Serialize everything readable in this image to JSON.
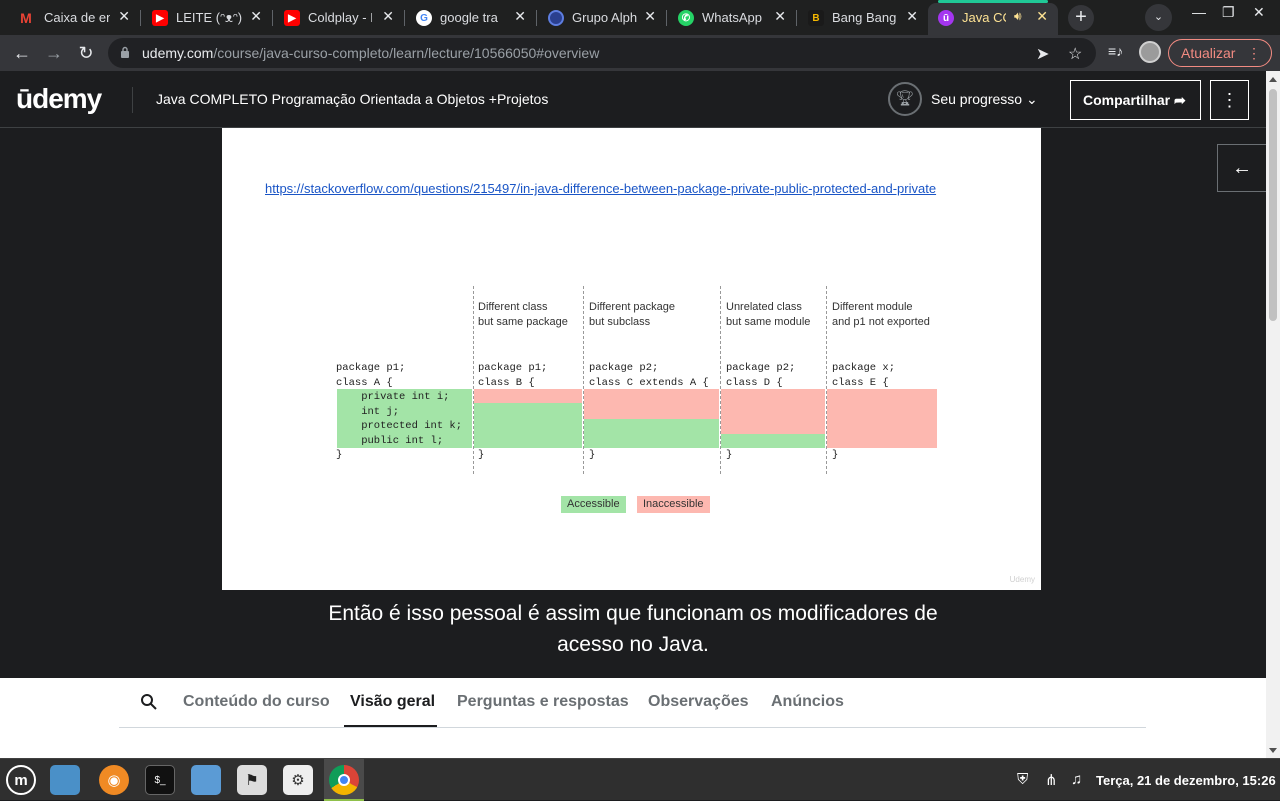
{
  "browser": {
    "tabs": [
      {
        "title": "Caixa de en",
        "icon": "gmail-icon",
        "color": "#ea4335",
        "glyph": "M"
      },
      {
        "title": "LEITE (ᵔᴥᵔ)",
        "icon": "youtube-icon",
        "color": "#ff0000",
        "glyph": "▶"
      },
      {
        "title": "Coldplay - I",
        "icon": "youtube-icon",
        "color": "#ff0000",
        "glyph": "▶"
      },
      {
        "title": "google tra",
        "icon": "google-icon",
        "color": "#4285f4",
        "glyph": "G"
      },
      {
        "title": "Grupo Alph",
        "icon": "circle-icon",
        "color": "#2a3f8f",
        "glyph": "●"
      },
      {
        "title": "WhatsApp",
        "icon": "whatsapp-icon",
        "color": "#25d366",
        "glyph": "✆"
      },
      {
        "title": "Bang Bang",
        "icon": "bang-icon",
        "color": "#d4a017",
        "glyph": "B"
      },
      {
        "title": "Java CO",
        "icon": "udemy-icon",
        "color": "#a435f0",
        "glyph": "ū",
        "active": true
      }
    ],
    "url_host": "udemy.com",
    "url_path": "/course/java-curso-completo/learn/lecture/10566050#overview",
    "update_label": "Atualizar"
  },
  "udemy": {
    "logo": "ūdemy",
    "course_title": "Java COMPLETO Programação Orientada a Objetos +Projetos",
    "progress_label": "Seu progresso",
    "share_label": "Compartilhar"
  },
  "slide": {
    "link": "https://stackoverflow.com/questions/215497/in-java-difference-between-package-private-public-protected-and-private",
    "columns": [
      "Different class\nbut same package",
      "Different package\nbut subclass",
      "Unrelated class\nbut same module",
      "Different module\nand p1 not exported"
    ],
    "class_a": "package p1;\nclass A {\n    private int i;\n    int j;\n    protected int k;\n    public int l;\n}",
    "class_b": "package p1;\nclass B {\n\n\n\n\n}",
    "class_c": "package p2;\nclass C extends A {\n\n\n\n\n}",
    "class_d": "package p2;\nclass D {\n\n\n\n\n}",
    "class_e": "package x;\nclass E {\n\n\n\n\n}",
    "legend_accessible": "Accessible",
    "legend_inaccessible": "Inaccessible",
    "watermark": "Udemy",
    "colors": {
      "accessible": "#a3e4a7",
      "inaccessible": "#fdb8b0"
    }
  },
  "caption": {
    "line1": "Então é isso pessoal é assim que funcionam os modificadores de",
    "line2": "acesso no Java."
  },
  "lower_tabs": [
    {
      "label": "Conteúdo do curso"
    },
    {
      "label": "Visão geral",
      "active": true
    },
    {
      "label": "Perguntas e respostas"
    },
    {
      "label": "Observações"
    },
    {
      "label": "Anúncios"
    }
  ],
  "taskbar": {
    "clock": "Terça, 21 de dezembro, 15:26"
  }
}
